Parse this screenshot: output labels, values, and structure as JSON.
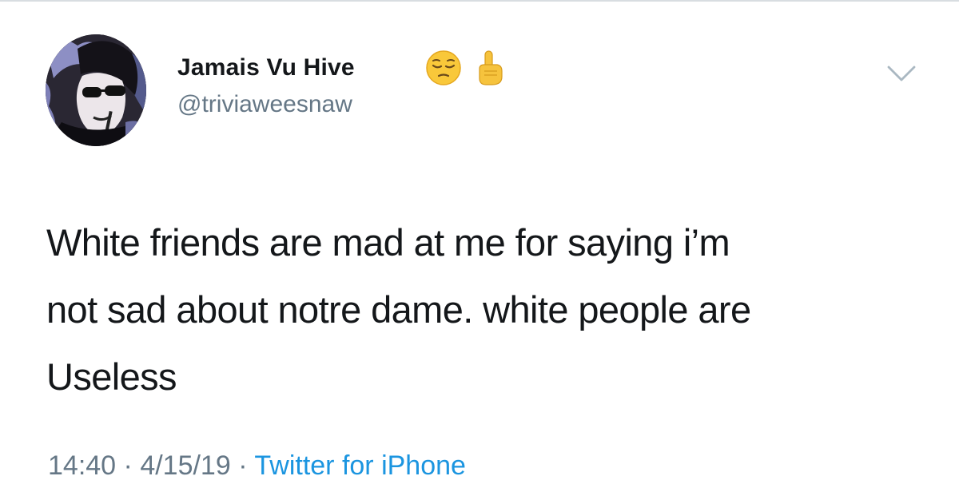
{
  "user": {
    "display_name": "Jamais Vu Hive",
    "emojis": [
      "pensive-face",
      "index-pointing-up"
    ],
    "handle": "@triviaweesnaw"
  },
  "tweet": {
    "lines": [
      "White friends are mad at me for saying i’m",
      "not sad about notre dame. white people are",
      "Useless"
    ]
  },
  "meta": {
    "time": "14:40",
    "separator": " · ",
    "date": "4/15/19",
    "source": "Twitter for iPhone"
  },
  "icons": {
    "menu": "chevron-down-icon"
  },
  "colors": {
    "text": "#14171a",
    "secondary": "#657786",
    "link": "#1b95e0"
  }
}
